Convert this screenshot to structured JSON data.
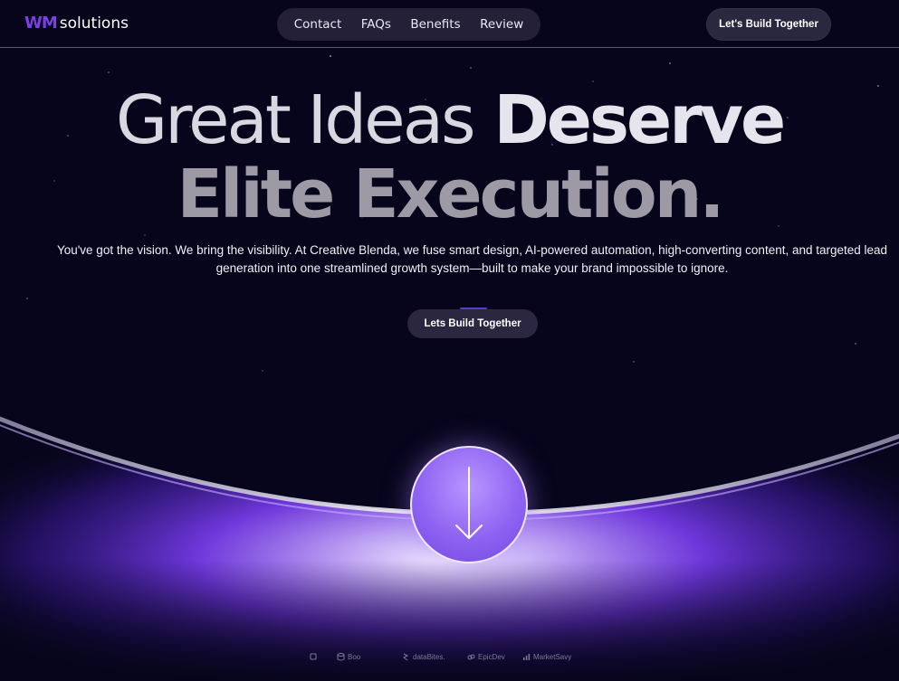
{
  "brand": {
    "mark": "WM",
    "name": "solutions"
  },
  "nav": {
    "links": [
      "Contact",
      "FAQs",
      "Benefits",
      "Review"
    ]
  },
  "header": {
    "cta_label": "Let's Build Together"
  },
  "hero": {
    "headline_line1_light": "Great Ideas",
    "headline_line1_bold": "Deserve",
    "headline_line2_bold": "Elite Execution.",
    "description": "You've got the vision. We bring the visibility. At Creative Blenda, we fuse smart design, AI-powered automation, high-converting content, and targeted lead generation into one streamlined growth system—built to make your brand impossible to ignore.",
    "cta_label": "Lets Build Together"
  },
  "scroll_button": {
    "icon": "arrow-down-icon"
  },
  "client_logos": [
    "Boo",
    "dataBites.",
    "EpicDev",
    "MarketSavy"
  ],
  "colors": {
    "background": "#07051c",
    "accent": "#7b3fe4",
    "glow": "#8a55f5"
  }
}
